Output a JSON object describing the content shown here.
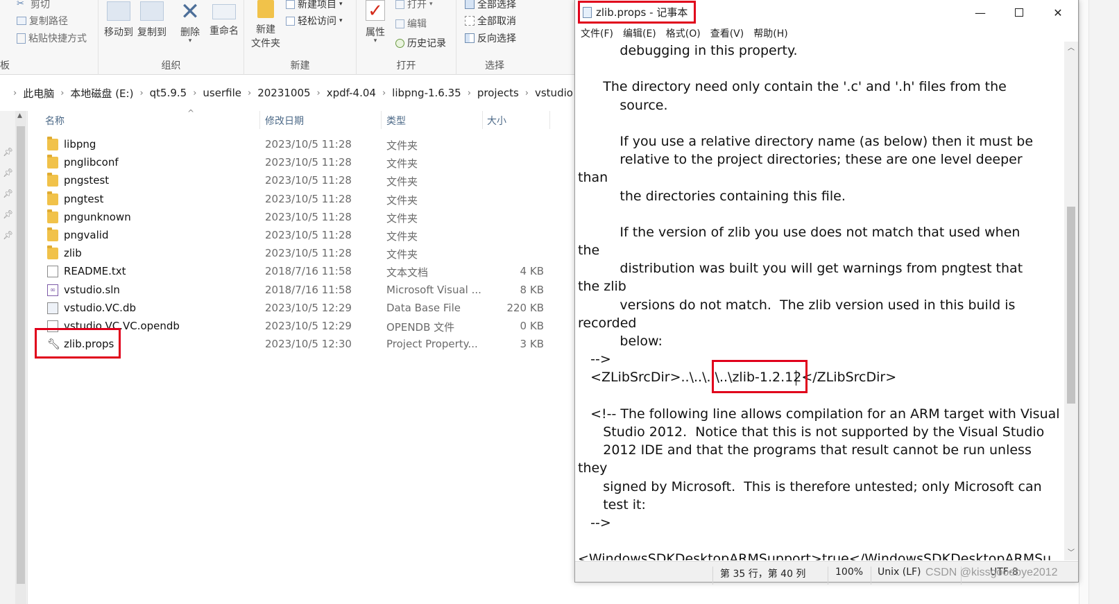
{
  "ribbon": {
    "clipboard": {
      "cut": "剪切",
      "copy_path": "复制路径",
      "paste_shortcut": "粘贴快捷方式",
      "group_label": "板"
    },
    "organize": {
      "move_to": "移动到",
      "copy_to": "复制到",
      "delete": "删除",
      "rename": "重命名",
      "group_label": "组织"
    },
    "new": {
      "new_folder_line1": "新建",
      "new_folder_line2": "文件夹",
      "new_item": "新建项目",
      "easy_access": "轻松访问",
      "group_label": "新建"
    },
    "open": {
      "properties": "属性",
      "open": "打开",
      "edit": "编辑",
      "history": "历史记录",
      "group_label": "打开"
    },
    "select": {
      "select_all": "全部选择",
      "select_none": "全部取消",
      "invert": "反向选择",
      "group_label": "选择"
    }
  },
  "address": {
    "crumbs": [
      "此电脑",
      "本地磁盘 (E:)",
      "qt5.9.5",
      "userfile",
      "20231005",
      "xpdf-4.04",
      "libpng-1.6.35",
      "projects",
      "vstudio"
    ]
  },
  "filelist": {
    "headers": {
      "name": "名称",
      "date": "修改日期",
      "type": "类型",
      "size": "大小"
    },
    "rows": [
      {
        "name": "libpng",
        "date": "2023/10/5 11:28",
        "type": "文件夹",
        "size": "",
        "icon": "folder-icon"
      },
      {
        "name": "pnglibconf",
        "date": "2023/10/5 11:28",
        "type": "文件夹",
        "size": "",
        "icon": "folder-icon"
      },
      {
        "name": "pngstest",
        "date": "2023/10/5 11:28",
        "type": "文件夹",
        "size": "",
        "icon": "folder-icon"
      },
      {
        "name": "pngtest",
        "date": "2023/10/5 11:28",
        "type": "文件夹",
        "size": "",
        "icon": "folder-icon"
      },
      {
        "name": "pngunknown",
        "date": "2023/10/5 11:28",
        "type": "文件夹",
        "size": "",
        "icon": "folder-icon"
      },
      {
        "name": "pngvalid",
        "date": "2023/10/5 11:28",
        "type": "文件夹",
        "size": "",
        "icon": "folder-icon"
      },
      {
        "name": "zlib",
        "date": "2023/10/5 11:28",
        "type": "文件夹",
        "size": "",
        "icon": "folder-icon"
      },
      {
        "name": "README.txt",
        "date": "2018/7/16 11:58",
        "type": "文本文档",
        "size": "4 KB",
        "icon": "text-file-icon"
      },
      {
        "name": "vstudio.sln",
        "date": "2018/7/16 11:58",
        "type": "Microsoft Visual ...",
        "size": "8 KB",
        "icon": "visual-studio-solution-icon"
      },
      {
        "name": "vstudio.VC.db",
        "date": "2023/10/5 12:29",
        "type": "Data Base File",
        "size": "220 KB",
        "icon": "database-file-icon"
      },
      {
        "name": "vstudio.VC.VC.opendb",
        "date": "2023/10/5 12:29",
        "type": "OPENDB 文件",
        "size": "0 KB",
        "icon": "generic-file-icon"
      },
      {
        "name": "zlib.props",
        "date": "2023/10/5 12:30",
        "type": "Project Property...",
        "size": "3 KB",
        "icon": "wrench-icon"
      }
    ]
  },
  "notepad": {
    "title": "zlib.props - 记事本",
    "menu": [
      "文件(F)",
      "编辑(E)",
      "格式(O)",
      "查看(V)",
      "帮助(H)"
    ],
    "lines": [
      "          debugging in this property.",
      "",
      "      The directory need only contain the '.c' and '.h' files from the",
      "          source.",
      "",
      "          If you use a relative directory name (as below) then it must be",
      "          relative to the project directories; these are one level deeper",
      "than",
      "          the directories containing this file.",
      "",
      "          If the version of zlib you use does not match that used when",
      "the",
      "          distribution was built you will get warnings from pngtest that",
      "the zlib",
      "          versions do not match.  The zlib version used in this build is",
      "recorded",
      "          below:",
      "   -->",
      "   <ZLibSrcDir>..\\..\\..\\..\\zlib-1.2.12</ZLibSrcDir>",
      "",
      "   <!-- The following line allows compilation for an ARM target with Visual",
      "      Studio 2012.  Notice that this is not supported by the Visual Studio",
      "      2012 IDE and that the programs that result cannot be run unless",
      "they",
      "      signed by Microsoft.  This is therefore untested; only Microsoft can",
      "      test it:",
      "   -->",
      "",
      "<WindowsSDKDesktopARMSupport>true</WindowsSDKDesktopARMSu"
    ],
    "status": {
      "position": "第 35 行，第 40 列",
      "zoom": "100%",
      "line_ending": "Unix (LF)",
      "encoding": "UTF-8"
    }
  },
  "watermark": "CSDN @kissgoodbye2012",
  "colors": {
    "highlight": "#e0001b",
    "folder": "#f1c24a"
  }
}
